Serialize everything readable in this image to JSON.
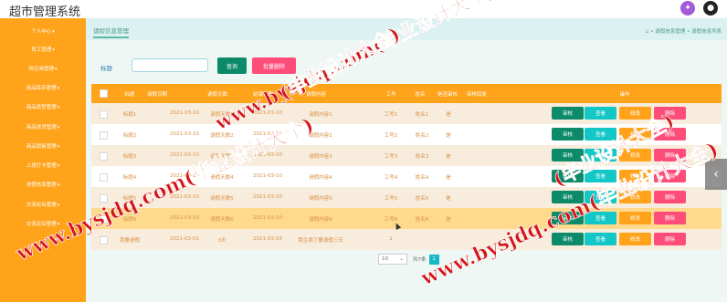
{
  "app_title": "超市管理系统",
  "sidebar": {
    "items": [
      "个人中心",
      "员工管理",
      "供应商管理",
      "商品库存管理",
      "商品类型管理",
      "商品进货管理",
      "商品销售管理",
      "上班打卡管理",
      "请假信息管理",
      "交流论坛管理",
      "交流论坛管理"
    ]
  },
  "tab": {
    "label": "请假信息管理"
  },
  "breadcrumb": {
    "home_icon": "home-icon",
    "sep1": "•",
    "level1": "请假信息管理",
    "sep2": "•",
    "level2": "请假信息列表"
  },
  "search": {
    "label": "标题",
    "value": "",
    "placeholder": ""
  },
  "buttons": {
    "query": "查询",
    "batch_delete": "批量删除"
  },
  "table": {
    "headers": [
      "标题",
      "请假日期",
      "请假天数",
      "结束日期",
      "请假内容",
      "工号",
      "姓名",
      "是否审核",
      "审核回复",
      "操作"
    ],
    "rows": [
      [
        "标题1",
        "2021-03-10",
        "请假天数1",
        "2021-03-10",
        "请假内容1",
        "工号1",
        "姓名1",
        "是",
        ""
      ],
      [
        "标题2",
        "2021-03-10",
        "请假天数2",
        "2021-03-10",
        "请假内容2",
        "工号2",
        "姓名2",
        "是",
        ""
      ],
      [
        "标题3",
        "2021-03-10",
        "请假天数3",
        "2021-03-10",
        "请假内容3",
        "工号3",
        "姓名3",
        "是",
        ""
      ],
      [
        "标题4",
        "2021-03-10",
        "请假天数4",
        "2021-03-10",
        "请假内容4",
        "工号4",
        "姓名4",
        "是",
        ""
      ],
      [
        "标题5",
        "2021-03-10",
        "请假天数5",
        "2021-03-10",
        "请假内容5",
        "工号5",
        "姓名5",
        "是",
        ""
      ],
      [
        "标题6",
        "2021-03-10",
        "请假天数6",
        "2021-03-10",
        "请假内容6",
        "工号6",
        "姓名6",
        "是",
        ""
      ],
      [
        "我要请假",
        "2021-03-01",
        "3天",
        "2021-03-03",
        "我生病了要请假三天",
        "1",
        "",
        "",
        ""
      ]
    ],
    "actions": {
      "audit": "审核",
      "view": "查看",
      "edit": "修改",
      "delete": "删除"
    }
  },
  "pagination": {
    "page_size": "10",
    "total": "共7条",
    "current_page": "1"
  },
  "watermark": {
    "text1": "www.bysjdq.com(毕业设计大全)",
    "text2": "www.bysjdq.com(毕业设计大全)",
    "text3": "(毕业设计大全)",
    "text4": "www.bysjdq.com(毕业设计大全)",
    "text5": "(毕业设计大全)"
  },
  "colors": {
    "sidebar": "#ffa31a",
    "header": "#ffa31a",
    "audit": "#0d8a6a",
    "view": "#13c7c7",
    "edit": "#ffa31a",
    "delete": "#ff4d7a",
    "watermark": "#d3161a"
  }
}
